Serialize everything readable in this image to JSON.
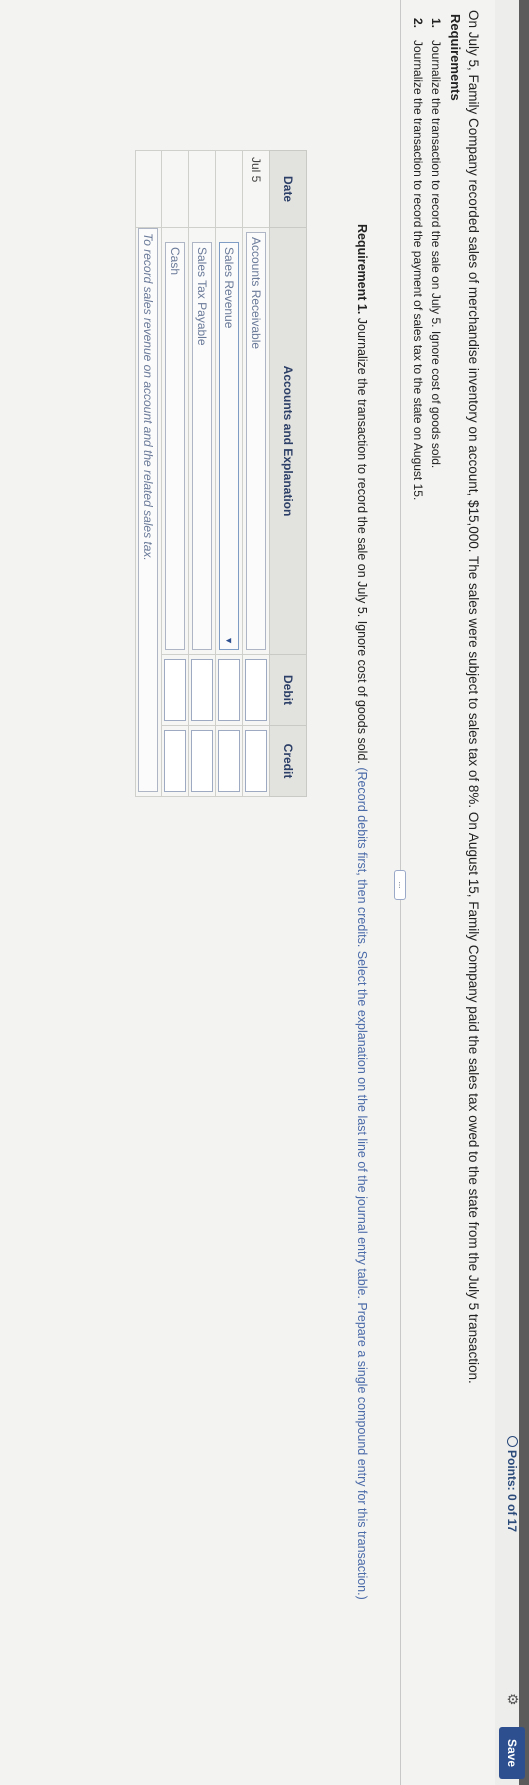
{
  "header": {
    "points": "Points: 0 of 17",
    "save_label": "Save"
  },
  "problem_text": "On July 5, Family Company recorded sales of merchandise inventory on account, $15,000. The sales were subject to sales tax of 8%. On August 15, Family Company paid the sales tax owed to the state from the July 5 transaction.",
  "requirements": {
    "title": "Requirements",
    "items": [
      {
        "num": "1.",
        "text": "Journalize the transaction to record the sale on July 5. Ignore cost of goods sold."
      },
      {
        "num": "2.",
        "text": "Journalize the transaction to record the payment of sales tax to the state on August 15."
      }
    ]
  },
  "more_label": "...",
  "instruction": {
    "label": "Requirement 1.",
    "text": " Journalize the transaction to record the sale on July 5. Ignore cost of goods sold.",
    "hint": " (Record debits first, then credits. Select the explanation on the last line of the journal entry table. Prepare a single compound entry for this transaction.)"
  },
  "journal": {
    "headers": {
      "date": "Date",
      "account": "Accounts and Explanation",
      "debit": "Debit",
      "credit": "Credit"
    },
    "date": "Jul 5",
    "rows": [
      {
        "account": "Accounts Receivable"
      },
      {
        "account": "Sales Revenue"
      },
      {
        "account": "Sales Tax Payable"
      },
      {
        "account": "Cash"
      }
    ],
    "explanation": "To record sales revenue on account and the related sales tax."
  }
}
